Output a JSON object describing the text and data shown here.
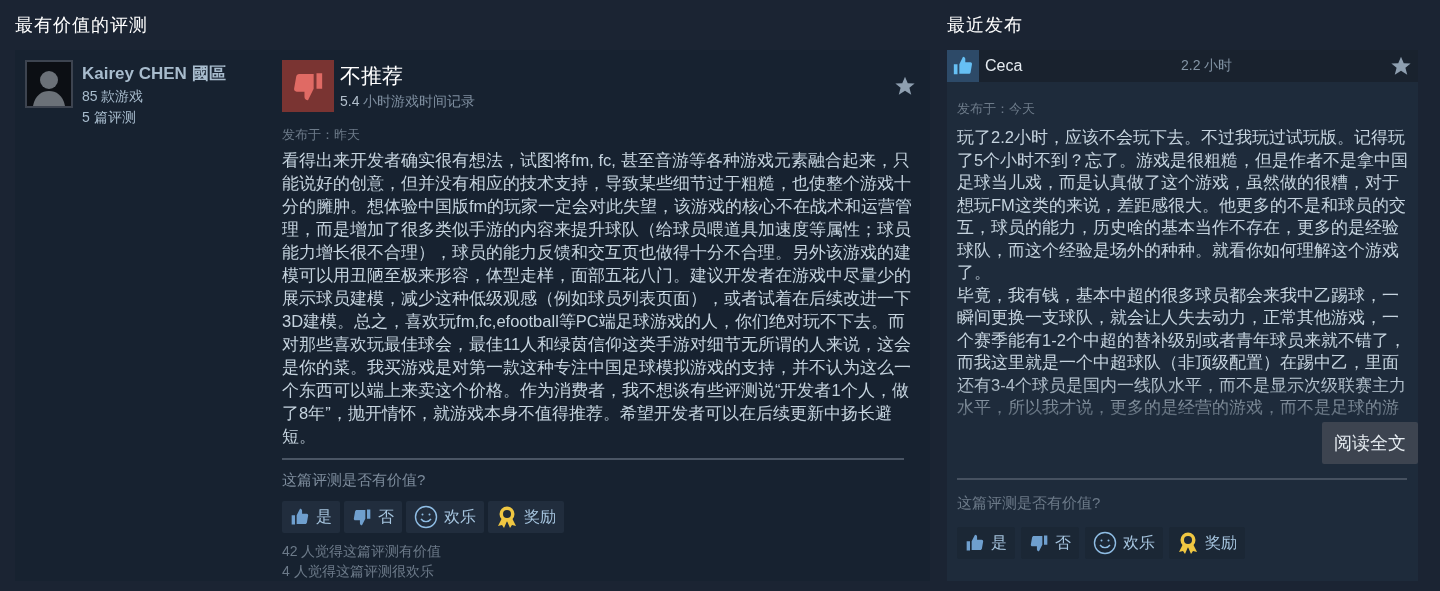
{
  "most_helpful": {
    "heading": "最有价值的评测",
    "review": {
      "author": {
        "name": "Kairey CHEN 國區",
        "games": "85 款游戏",
        "reviews": "5 篇评测"
      },
      "recommendation": {
        "kind": "not_recommended",
        "label": "不推荐",
        "hours": "5.4",
        "hours_label": "小时游戏时间记录"
      },
      "posted": "发布于：昨天",
      "body": "看得出来开发者确实很有想法，试图将fm, fc, 甚至音游等各种游戏元素融合起来，只能说好的创意，但并没有相应的技术支持，导致某些细节过于粗糙，也使整个游戏十分的臃肿。想体验中国版fm的玩家一定会对此失望，该游戏的核心不在战术和运营管理，而是增加了很多类似手游的内容来提升球队（给球员喂道具加速度等属性；球员能力增长很不合理），球员的能力反馈和交互页也做得十分不合理。另外该游戏的建模可以用丑陋至极来形容，体型走样，面部五花八门。建议开发者在游戏中尽量少的展示球员建模，减少这种低级观感（例如球员列表页面），或者试着在后续改进一下3D建模。总之，喜欢玩fm,fc,efootball等PC端足球游戏的人，你们绝对玩不下去。而对那些喜欢玩最佳球会，最佳11人和绿茵信仰这类手游对细节无所谓的人来说，这会是你的菜。我买游戏是对第一款这种专注中国足球模拟游戏的支持，并不认为这么一个东西可以端上来卖这个价格。作为消费者，我不想谈有些评测说“开发者1个人，做了8年”，抛开情怀，就游戏本身不值得推荐。希望开发者可以在后续更新中扬长避短。",
      "helpful_prompt": "这篇评测是否有价值?",
      "votes": [
        {
          "kind": "yes",
          "label": "是"
        },
        {
          "kind": "no",
          "label": "否"
        },
        {
          "kind": "funny",
          "label": "欢乐"
        },
        {
          "kind": "award",
          "label": "奖励"
        }
      ],
      "stats": [
        "42 人觉得这篇评测有价值",
        "4 人觉得这篇评测很欢乐"
      ]
    }
  },
  "recent": {
    "heading": "最近发布",
    "review": {
      "author": "Ceca",
      "recommendation": {
        "kind": "recommended"
      },
      "hours": "2.2 小时",
      "posted": "发布于：今天",
      "paragraphs": [
        "玩了2.2小时，应该不会玩下去。不过我玩过试玩版。记得玩了5个小时不到？忘了。游戏是很粗糙，但是作者不是拿中国足球当儿戏，而是认真做了这个游戏，虽然做的很糟，对于想玩FM这类的来说，差距感很大。他更多的不是和球员的交互，球员的能力，历史啥的基本当作不存在，更多的是经验球队，而这个经验是场外的种种。就看你如何理解这个游戏了。",
        "毕竟，我有钱，基本中超的很多球员都会来我中乙踢球，一瞬间更换一支球队，就会让人失去动力，正常其他游戏，一个赛季能有1-2个中超的替补级别或者青年球员来就不错了，而我这里就是一个中超球队（非顶级配置）在踢中乙，里面还有3-4个球员是国内一线队水平，而不是显示次级联赛主力水平，所以我才说，更多的是经营的游戏，而不是足球的游"
      ],
      "read_more": "阅读全文",
      "helpful_prompt": "这篇评测是否有价值?",
      "votes": [
        {
          "kind": "yes",
          "label": "是"
        },
        {
          "kind": "no",
          "label": "否"
        },
        {
          "kind": "funny",
          "label": "欢乐"
        },
        {
          "kind": "award",
          "label": "奖励"
        }
      ]
    }
  }
}
